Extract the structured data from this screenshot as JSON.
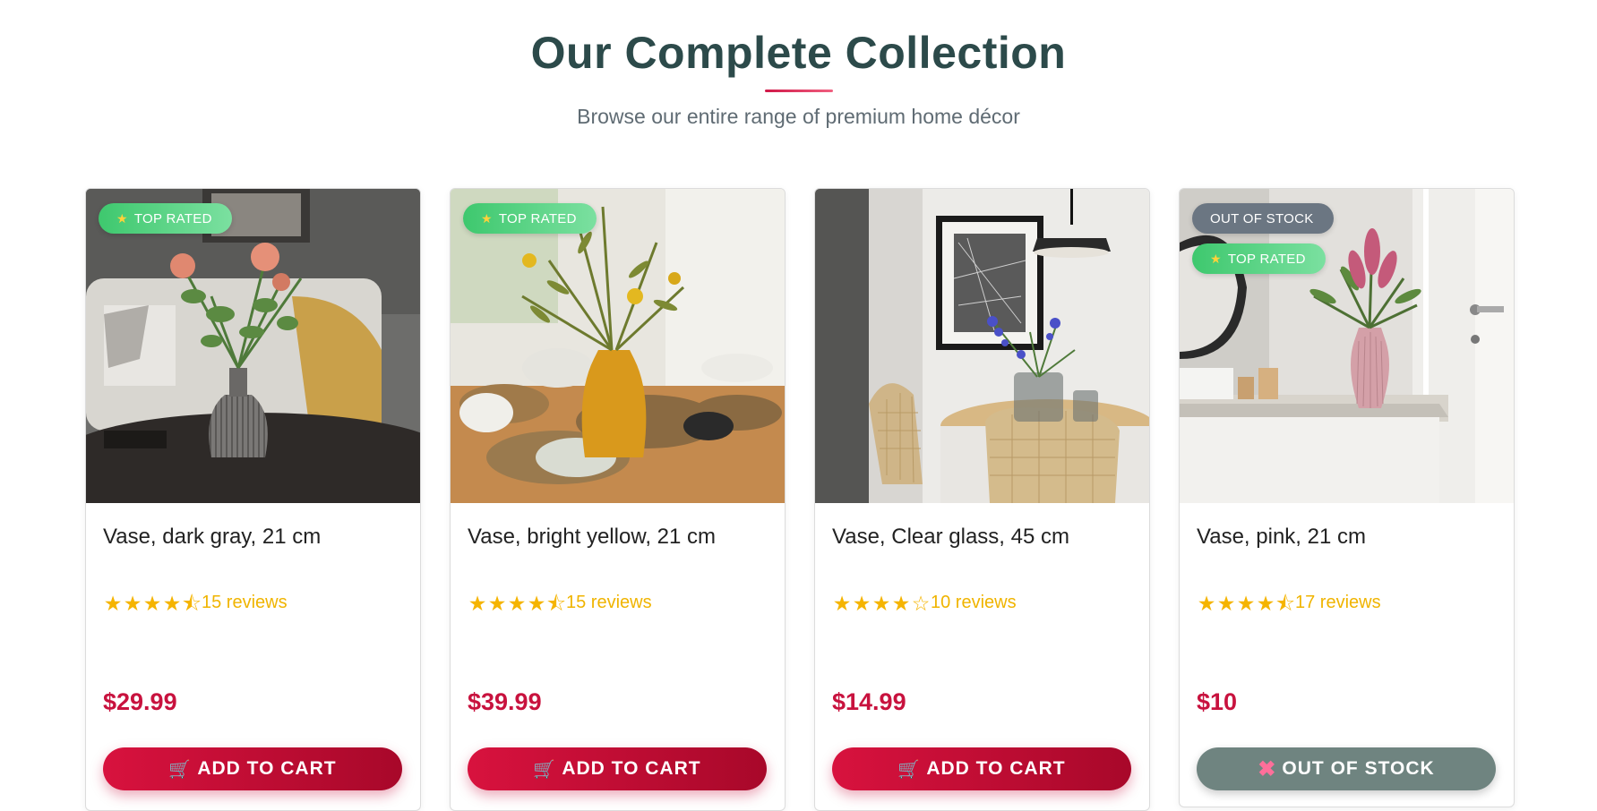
{
  "header": {
    "title": "Our Complete Collection",
    "subtitle": "Browse our entire range of premium home décor"
  },
  "products": [
    {
      "name": "Vase, dark gray, 21 cm",
      "reviews": "15 reviews",
      "rating": 4.5,
      "price": "$29.99",
      "badges": [
        "TOP RATED"
      ],
      "button": "ADD TO CART"
    },
    {
      "name": "Vase, bright yellow, 21 cm",
      "reviews": "15 reviews",
      "rating": 4.5,
      "price": "$39.99",
      "badges": [
        "TOP RATED"
      ],
      "button": "ADD TO CART"
    },
    {
      "name": "Vase, Clear glass, 45 cm",
      "reviews": "10 reviews",
      "rating": 4,
      "price": "$14.99",
      "badges": [],
      "button": "ADD TO CART"
    },
    {
      "name": "Vase, pink, 21 cm",
      "reviews": "17 reviews",
      "rating": 4.5,
      "price": "$10",
      "badges": [
        "OUT OF STOCK",
        "TOP RATED"
      ],
      "button": "OUT OF STOCK"
    }
  ],
  "colors": {
    "accent": "#c8123e",
    "title": "#2c4a4a",
    "star": "#f5b400",
    "top_rated_badge": "#3ec86e",
    "out_of_stock_button": "#6f8480"
  }
}
